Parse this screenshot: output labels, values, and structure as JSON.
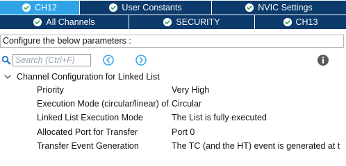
{
  "tabs_row1": [
    {
      "label": "CH12",
      "active": true
    },
    {
      "label": "User Constants",
      "active": false
    },
    {
      "label": "NVIC Settings",
      "active": false
    }
  ],
  "tabs_row2": [
    {
      "label": "All Channels",
      "active": false
    },
    {
      "label": "SECURITY",
      "active": false
    },
    {
      "label": "CH13",
      "active": false
    }
  ],
  "configure_text": "Configure the below parameters :",
  "search": {
    "placeholder": "Search (Ctrl+F)",
    "value": ""
  },
  "group": {
    "label": "Channel Configuration for Linked List",
    "expanded": true
  },
  "parameters": [
    {
      "name": "Priority",
      "value": "Very High"
    },
    {
      "name": "Execution Mode (circular/linear) of",
      "value": "Circular"
    },
    {
      "name": "Linked List Execution Mode",
      "value": "The List is fully executed"
    },
    {
      "name": "Allocated Port for Transfer",
      "value": "Port 0"
    },
    {
      "name": "Transfer Event Generation",
      "value": "The TC (and the HT) event is generated at t"
    }
  ],
  "colors": {
    "tab_bg": "#0b3a6b",
    "tab_active_bg": "#2fa3e6",
    "check_green": "#2fa35a",
    "nav_icon": "#2fa3e6",
    "search_icon": "#1f6fd1",
    "info_icon": "#5a5a5a"
  },
  "icons": {
    "tab_status": "check-circle-icon",
    "search": "search-icon",
    "prev": "chevron-left-circle-icon",
    "next": "chevron-right-circle-icon",
    "info": "info-icon",
    "expand": "chevron-down-icon"
  }
}
